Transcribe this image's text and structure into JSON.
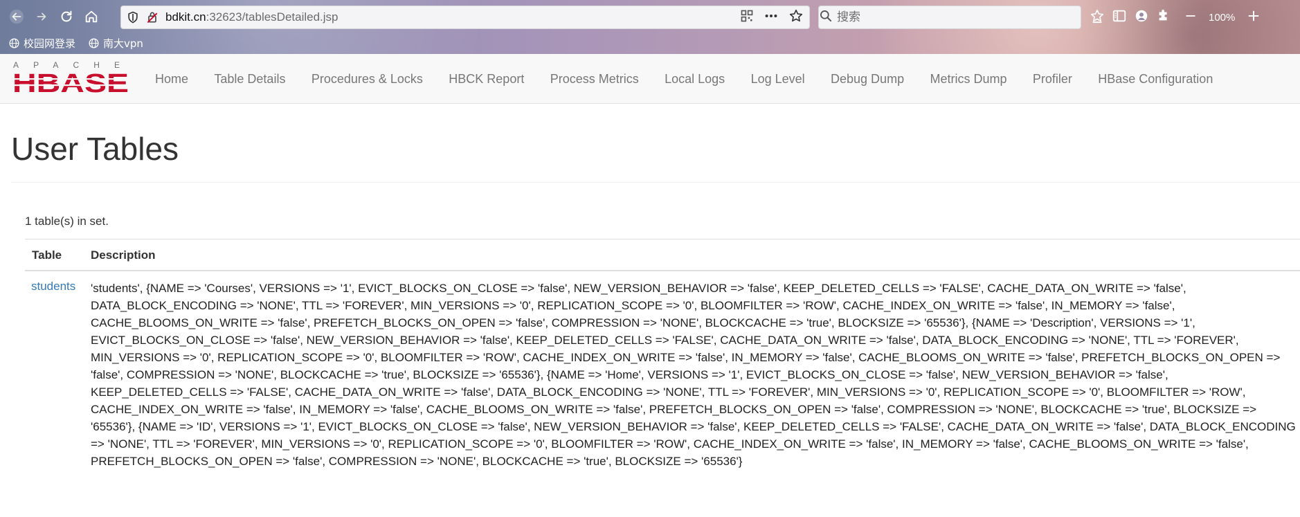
{
  "browser": {
    "url_host": "bdkit.cn",
    "url_rest": ":32623/tablesDetailed.jsp",
    "search_placeholder": "搜索",
    "zoom": "100%",
    "bookmarks": [
      {
        "label": "校园网登录"
      },
      {
        "label": "南大vpn"
      }
    ]
  },
  "navbar": {
    "logo_top": "APACHE",
    "logo_bottom": "HBASE",
    "links": [
      {
        "label": "Home"
      },
      {
        "label": "Table Details"
      },
      {
        "label": "Procedures & Locks"
      },
      {
        "label": "HBCK Report"
      },
      {
        "label": "Process Metrics"
      },
      {
        "label": "Local Logs"
      },
      {
        "label": "Log Level"
      },
      {
        "label": "Debug Dump"
      },
      {
        "label": "Metrics Dump"
      },
      {
        "label": "Profiler"
      },
      {
        "label": "HBase Configuration"
      }
    ]
  },
  "main": {
    "title": "User Tables",
    "count_text": "1 table(s) in set.",
    "table": {
      "headers": [
        "Table",
        "Description"
      ],
      "rows": [
        {
          "name": "students",
          "description": "'students', {NAME => 'Courses', VERSIONS => '1', EVICT_BLOCKS_ON_CLOSE => 'false', NEW_VERSION_BEHAVIOR => 'false', KEEP_DELETED_CELLS => 'FALSE', CACHE_DATA_ON_WRITE => 'false', DATA_BLOCK_ENCODING => 'NONE', TTL => 'FOREVER', MIN_VERSIONS => '0', REPLICATION_SCOPE => '0', BLOOMFILTER => 'ROW', CACHE_INDEX_ON_WRITE => 'false', IN_MEMORY => 'false', CACHE_BLOOMS_ON_WRITE => 'false', PREFETCH_BLOCKS_ON_OPEN => 'false', COMPRESSION => 'NONE', BLOCKCACHE => 'true', BLOCKSIZE => '65536'}, {NAME => 'Description', VERSIONS => '1', EVICT_BLOCKS_ON_CLOSE => 'false', NEW_VERSION_BEHAVIOR => 'false', KEEP_DELETED_CELLS => 'FALSE', CACHE_DATA_ON_WRITE => 'false', DATA_BLOCK_ENCODING => 'NONE', TTL => 'FOREVER', MIN_VERSIONS => '0', REPLICATION_SCOPE => '0', BLOOMFILTER => 'ROW', CACHE_INDEX_ON_WRITE => 'false', IN_MEMORY => 'false', CACHE_BLOOMS_ON_WRITE => 'false', PREFETCH_BLOCKS_ON_OPEN => 'false', COMPRESSION => 'NONE', BLOCKCACHE => 'true', BLOCKSIZE => '65536'}, {NAME => 'Home', VERSIONS => '1', EVICT_BLOCKS_ON_CLOSE => 'false', NEW_VERSION_BEHAVIOR => 'false', KEEP_DELETED_CELLS => 'FALSE', CACHE_DATA_ON_WRITE => 'false', DATA_BLOCK_ENCODING => 'NONE', TTL => 'FOREVER', MIN_VERSIONS => '0', REPLICATION_SCOPE => '0', BLOOMFILTER => 'ROW', CACHE_INDEX_ON_WRITE => 'false', IN_MEMORY => 'false', CACHE_BLOOMS_ON_WRITE => 'false', PREFETCH_BLOCKS_ON_OPEN => 'false', COMPRESSION => 'NONE', BLOCKCACHE => 'true', BLOCKSIZE => '65536'}, {NAME => 'ID', VERSIONS => '1', EVICT_BLOCKS_ON_CLOSE => 'false', NEW_VERSION_BEHAVIOR => 'false', KEEP_DELETED_CELLS => 'FALSE', CACHE_DATA_ON_WRITE => 'false', DATA_BLOCK_ENCODING => 'NONE', TTL => 'FOREVER', MIN_VERSIONS => '0', REPLICATION_SCOPE => '0', BLOOMFILTER => 'ROW', CACHE_INDEX_ON_WRITE => 'false', IN_MEMORY => 'false', CACHE_BLOOMS_ON_WRITE => 'false', PREFETCH_BLOCKS_ON_OPEN => 'false', COMPRESSION => 'NONE', BLOCKCACHE => 'true', BLOCKSIZE => '65536'}"
        }
      ]
    }
  },
  "colors": {
    "link": "#337ab7",
    "logo_red": "#c8102e",
    "logo_gray": "#6d6e71"
  },
  "icons": [
    "back-icon",
    "forward-icon",
    "reload-icon",
    "home-icon",
    "shield-icon",
    "insecure-lock-icon",
    "qr-code-icon",
    "more-icon",
    "star-icon",
    "search-icon",
    "bookmark-star-icon",
    "sidebar-icon",
    "account-icon",
    "extension-icon",
    "zoom-out-icon",
    "zoom-in-icon",
    "globe-icon"
  ]
}
